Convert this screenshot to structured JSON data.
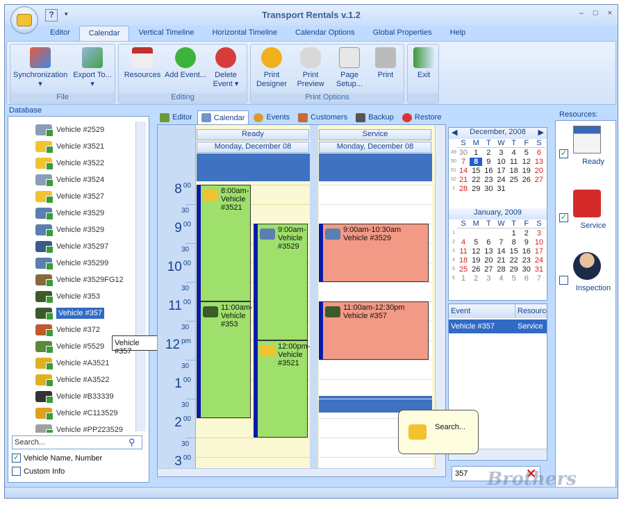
{
  "app": {
    "title": "Transport Rentals v.1.2"
  },
  "window": {
    "minimize": "–",
    "maximize": "□",
    "close": "×"
  },
  "menu": [
    "Editor",
    "Calendar",
    "Vertical Timeline",
    "Horizontal Timeline",
    "Calendar Options",
    "Global Properties",
    "Help"
  ],
  "ribbon": {
    "file": {
      "label": "File",
      "sync": "Synchronization",
      "export": "Export To..."
    },
    "editing": {
      "label": "Editing",
      "resources": "Resources",
      "add": "Add Event...",
      "delete": "Delete Event"
    },
    "print": {
      "label": "Print Options",
      "designer": "Print Designer",
      "preview": "Print Preview",
      "setup": "Page Setup...",
      "print": "Print"
    },
    "exit": "Exit"
  },
  "database": {
    "title": "Database",
    "items": [
      "Vehicle #2529",
      "Vehicle #3521",
      "Vehicle #3522",
      "Vehicle #3524",
      "Vehicle #3527",
      "Vehicle #3529",
      "Vehicle #3529",
      "Vehicle #35297",
      "Vehicle #35299",
      "Vehicle #3529FG12",
      "Vehicle #353",
      "Vehicle #357",
      "Vehicle #372",
      "Vehicle #5529",
      "Vehicle #A3521",
      "Vehicle #A3522",
      "Vehicle #B33339",
      "Vehicle #C113529",
      "Vehicle #PP223529"
    ],
    "search_placeholder": "Search...",
    "opt1": "Vehicle Name, Number",
    "opt2": "Custom Info",
    "tooltip": "Vehicle #357"
  },
  "tabs": [
    "Editor",
    "Calendar",
    "Events",
    "Customers",
    "Backup",
    "Restore"
  ],
  "calendar": {
    "columns": [
      {
        "name": "Ready",
        "date": "Monday, December 08"
      },
      {
        "name": "Service",
        "date": "Monday, December 08"
      }
    ],
    "hours": [
      {
        "h": "8",
        "m": "00"
      },
      {
        "h": "9",
        "m": "00"
      },
      {
        "h": "10",
        "m": "00"
      },
      {
        "h": "11",
        "m": "00"
      },
      {
        "h": "12",
        "m": "pm"
      },
      {
        "h": "1",
        "m": "00"
      },
      {
        "h": "2",
        "m": "00"
      },
      {
        "h": "3",
        "m": "00"
      }
    ],
    "half": "30",
    "events": {
      "e1": "8:00am-Vehicle #3521",
      "e2": "9:00am-Vehicle #3529",
      "e3": "11:00am-Vehicle #353",
      "e4": "12:00pm-Vehicle #3521",
      "e5": "9:00am-10:30am Vehicle #3529",
      "e6": "11:00am-12:30pm Vehicle #357"
    }
  },
  "mini": {
    "dec": {
      "title": "December, 2008",
      "days": [
        "S",
        "M",
        "T",
        "W",
        "T",
        "F",
        "S"
      ],
      "weeks": [
        [
          "49",
          "30",
          "1",
          "2",
          "3",
          "4",
          "5",
          "6"
        ],
        [
          "50",
          "7",
          "8",
          "9",
          "10",
          "11",
          "12",
          "13"
        ],
        [
          "51",
          "14",
          "15",
          "16",
          "17",
          "18",
          "19",
          "20"
        ],
        [
          "52",
          "21",
          "22",
          "23",
          "24",
          "25",
          "26",
          "27"
        ],
        [
          "1",
          "28",
          "29",
          "30",
          "31",
          "",
          "",
          ""
        ]
      ]
    },
    "jan": {
      "title": "January, 2009",
      "weeks": [
        [
          "1",
          "",
          "",
          "",
          "",
          "1",
          "2",
          "3"
        ],
        [
          "2",
          "4",
          "5",
          "6",
          "7",
          "8",
          "9",
          "10"
        ],
        [
          "3",
          "11",
          "12",
          "13",
          "14",
          "15",
          "16",
          "17"
        ],
        [
          "4",
          "18",
          "19",
          "20",
          "21",
          "22",
          "23",
          "24"
        ],
        [
          "5",
          "25",
          "26",
          "27",
          "28",
          "29",
          "30",
          "31"
        ],
        [
          "6",
          "1",
          "2",
          "3",
          "4",
          "5",
          "6",
          "7"
        ]
      ]
    }
  },
  "evlist": {
    "col1": "Event",
    "col2": "Resource",
    "row1": "Vehicle #357",
    "row2": "Service"
  },
  "search": {
    "value": "357",
    "callout": "Search..."
  },
  "resources": {
    "title": "Resources:",
    "items": [
      "Ready",
      "Service",
      "Inspection"
    ]
  },
  "watermark": "Brothers",
  "colors": {
    "green": "#9ee06b",
    "red": "#f39a86",
    "selection": "#316ac5"
  }
}
